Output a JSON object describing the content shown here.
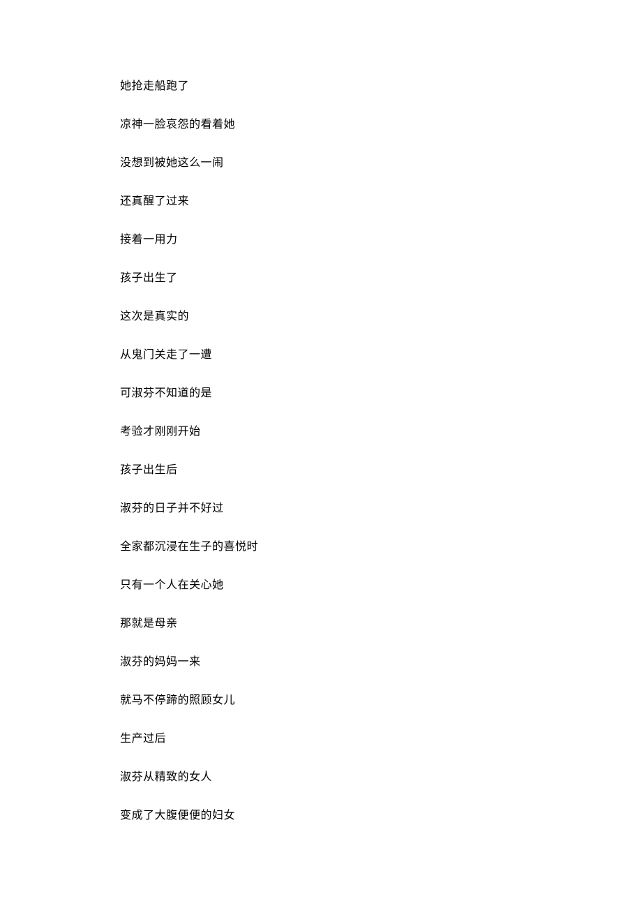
{
  "lines": [
    "她抢走船跑了",
    "凉神一脸哀怨的看着她",
    "没想到被她这么一闹",
    "还真醒了过来",
    "接着一用力",
    "孩子出生了",
    "这次是真实的",
    "从鬼门关走了一遭",
    "可淑芬不知道的是",
    "考验才刚刚开始",
    "孩子出生后",
    "淑芬的日子并不好过",
    "全家都沉浸在生子的喜悦时",
    "只有一个人在关心她",
    "那就是母亲",
    "淑芬的妈妈一来",
    "就马不停蹄的照顾女儿",
    "生产过后",
    "淑芬从精致的女人",
    "变成了大腹便便的妇女"
  ]
}
